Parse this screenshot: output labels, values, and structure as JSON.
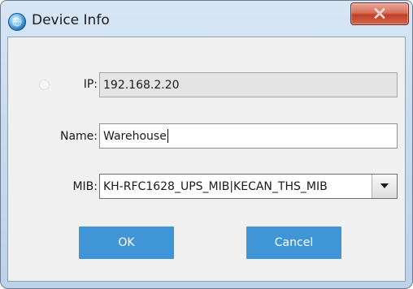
{
  "window": {
    "title": "Device Info",
    "icon": "app-globe-icon",
    "close_icon": "close-icon"
  },
  "form": {
    "ip": {
      "label": "IP:",
      "value": "192.168.2.20"
    },
    "name": {
      "label": "Name:",
      "value": "Warehouse"
    },
    "mib": {
      "label": "MIB:",
      "value": "KH-RFC1628_UPS_MIB|KECAN_THS_MIB"
    }
  },
  "buttons": {
    "ok": "OK",
    "cancel": "Cancel"
  },
  "colors": {
    "button_bg": "#3f95d6",
    "close_red": "#c04128"
  }
}
